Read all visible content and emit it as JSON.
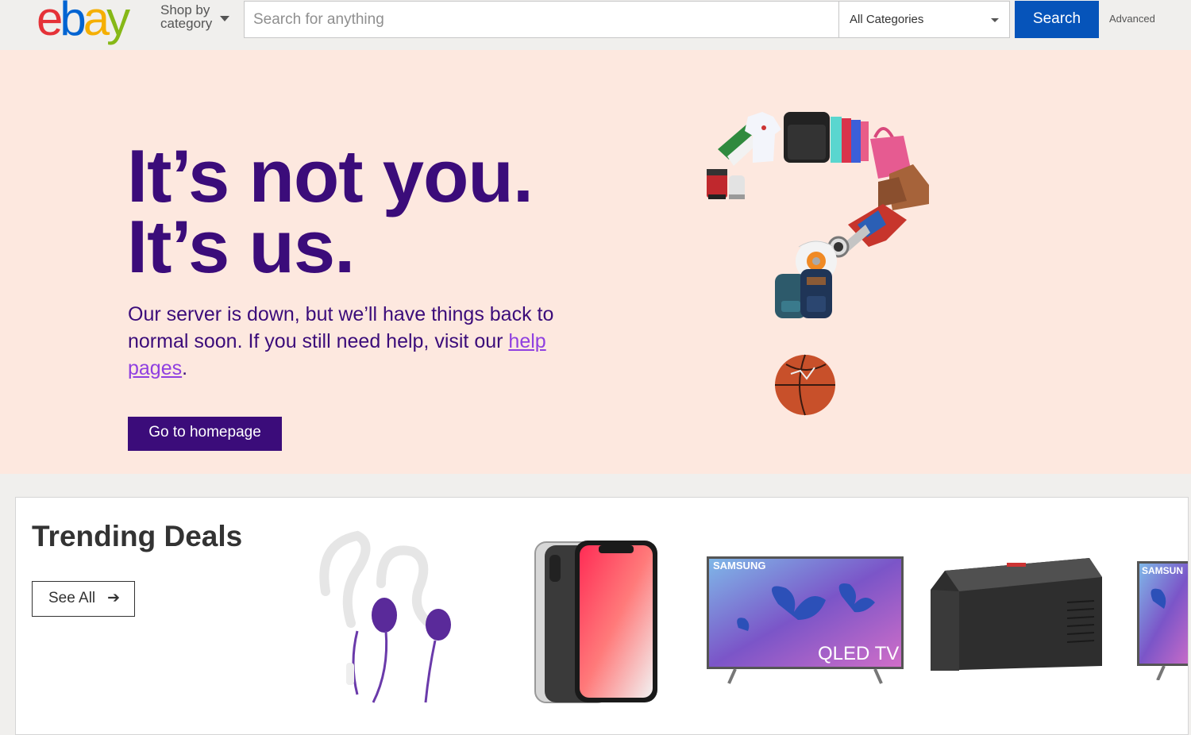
{
  "header": {
    "logo_letters": [
      {
        "char": "e",
        "color": "#e53238"
      },
      {
        "char": "b",
        "color": "#0064d2"
      },
      {
        "char": "a",
        "color": "#f5af02"
      },
      {
        "char": "y",
        "color": "#86b817"
      }
    ],
    "shop_by_label": "Shop by category",
    "search_placeholder": "Search for anything",
    "category_value": "All Categories",
    "search_button": "Search",
    "advanced_link": "Advanced"
  },
  "hero": {
    "headline_line1": "It’s not you.",
    "headline_line2": "It’s us.",
    "message_prefix": "Our server is down, but we’ll have things back to normal soon. If you still need help, visit our ",
    "message_link": "help pages",
    "message_suffix": ".",
    "home_button": "Go to homepage",
    "colors": {
      "background": "#fde8df",
      "text": "#3b0c7a",
      "link": "#8f3fe0"
    }
  },
  "trending": {
    "title": "Trending Deals",
    "see_all": "See All",
    "products": [
      {
        "name": "earphones-icon",
        "tv_brand": ""
      },
      {
        "name": "smartphone-icon",
        "tv_brand": ""
      },
      {
        "name": "tv-icon",
        "tv_brand": "SAMSUNG",
        "tv_model": "QLED TV"
      },
      {
        "name": "generator-icon",
        "tv_brand": ""
      },
      {
        "name": "tv-icon",
        "tv_brand": "SAMSUN"
      }
    ]
  }
}
